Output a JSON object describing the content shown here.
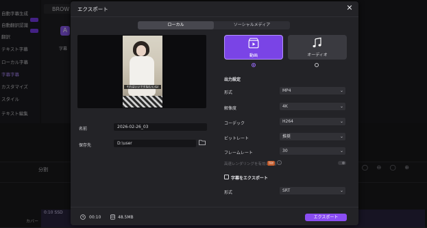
{
  "background": {
    "sidebar_items": [
      "自動字幕生成",
      "自動翻訳認識",
      "翻訳",
      "テキスト字幕",
      "ローカル字幕",
      "字幕字幕",
      "カスタマイズ",
      "スタイル",
      "テキスト編集"
    ],
    "top_tab": "BROW",
    "panel_item": "字幕",
    "toolbar_text": "分割",
    "clip_label": "0:10 SSD",
    "cover_label": "カバー"
  },
  "dialog": {
    "title": "エクスポート",
    "close_icon": "close-icon",
    "tabs": [
      {
        "label": "ローカル",
        "active": true
      },
      {
        "label": "ソーシャルメディア",
        "active": false
      }
    ],
    "preview": {
      "subtitle_text": "それはいいですね(いいね)"
    },
    "name_label": "名前",
    "name_value": "2026-02-26_03",
    "save_label": "保存先",
    "save_value": "D:\\user",
    "folder_icon": "folder-icon",
    "format_cards": [
      {
        "label": "動画",
        "icon": "video-icon",
        "selected": true
      },
      {
        "label": "オーディオ",
        "icon": "music-note-icon",
        "selected": false
      }
    ],
    "output_title": "出力設定",
    "settings": [
      {
        "label": "形式",
        "value": "MP4"
      },
      {
        "label": "解像度",
        "value": "4K"
      },
      {
        "label": "コーデック",
        "value": "H264"
      },
      {
        "label": "ビットレート",
        "value": "推奨"
      },
      {
        "label": "フレームレート",
        "value": "30"
      }
    ],
    "gpu_label": "高速レンダリングを有効にする",
    "gpu_badge": "TRY",
    "subtitle_export_label": "字幕をエクスポート",
    "subtitle_format_label": "形式",
    "subtitle_format_value": "SRT",
    "footer": {
      "duration": "00:10",
      "size": "48.5MB",
      "export_label": "エクスポート"
    },
    "colors": {
      "accent": "#8a4df2",
      "dialog_bg": "#232327"
    }
  }
}
